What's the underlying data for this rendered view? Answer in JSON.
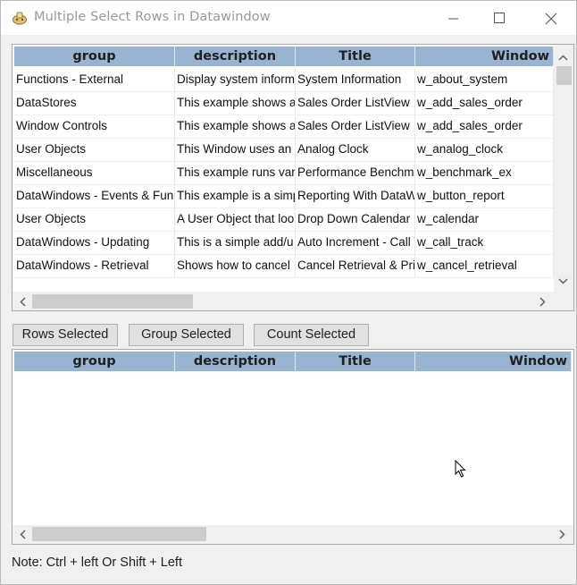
{
  "window": {
    "title": "Multiple Select Rows in Datawindow"
  },
  "columns": [
    "group",
    "description",
    "Title",
    "Window"
  ],
  "top_grid": {
    "rows": [
      [
        "Functions - External",
        "Display system informa",
        "System Information",
        "w_about_system"
      ],
      [
        "DataStores",
        "This example shows a",
        "Sales Order ListView",
        "w_add_sales_order"
      ],
      [
        "Window Controls",
        "This example shows a",
        "Sales Order ListView",
        "w_add_sales_order"
      ],
      [
        "User Objects",
        "This Window uses an",
        "Analog Clock",
        "w_analog_clock"
      ],
      [
        "Miscellaneous",
        "This example runs vari",
        "Performance Benchma",
        "w_benchmark_ex"
      ],
      [
        "DataWindows - Events & Func",
        "This example is a simp",
        "Reporting With DataW",
        "w_button_report"
      ],
      [
        "User Objects",
        "A User Object that lool",
        "Drop Down Calendar",
        "w_calendar"
      ],
      [
        "DataWindows - Updating",
        "This is a simple add/u",
        "Auto Increment - Call T",
        "w_call_track"
      ],
      [
        "DataWindows - Retrieval",
        "Shows how to cancel",
        "Cancel Retrieval & Prir",
        "w_cancel_retrieval"
      ]
    ]
  },
  "buttons": {
    "rows_selected": "Rows Selected",
    "group_selected": "Group Selected",
    "count_selected": "Count Selected"
  },
  "note": "Note: Ctrl + left Or Shift + Left",
  "icons": {
    "app": "datawindow-app-icon",
    "minimize": "minimize-icon",
    "maximize": "maximize-icon",
    "close": "close-icon",
    "cursor": "mouse-pointer-icon"
  }
}
